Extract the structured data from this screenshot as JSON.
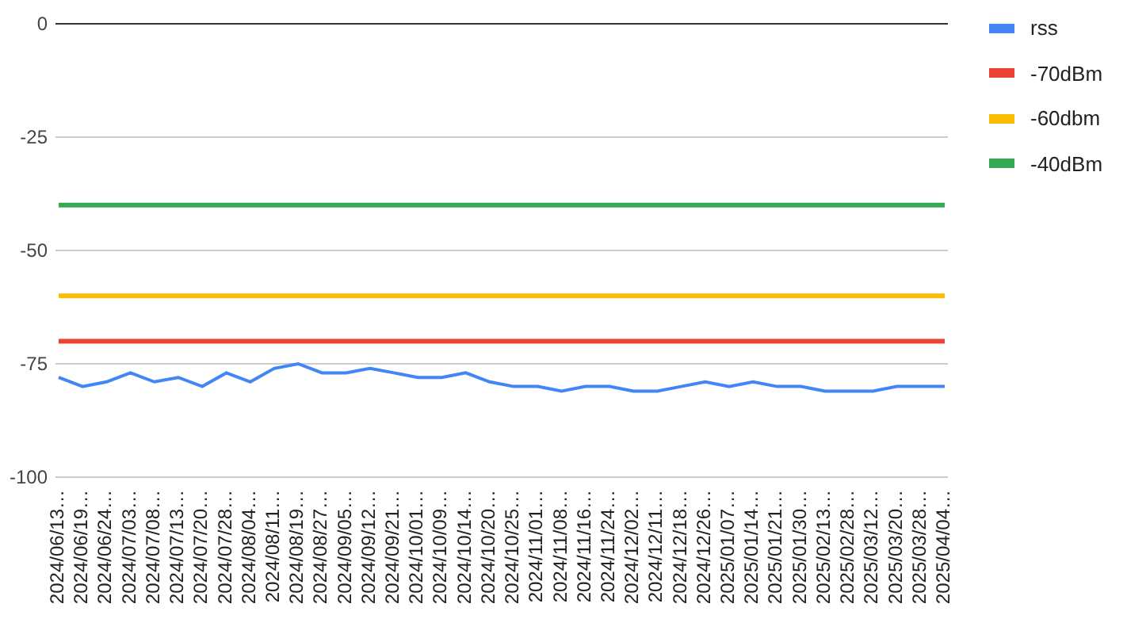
{
  "chart_data": {
    "type": "line",
    "categories": [
      "2024/06/13…",
      "2024/06/19…",
      "2024/06/24…",
      "2024/07/03…",
      "2024/07/08…",
      "2024/07/13…",
      "2024/07/20…",
      "2024/07/28…",
      "2024/08/04…",
      "2024/08/11…",
      "2024/08/19…",
      "2024/08/27…",
      "2024/09/05…",
      "2024/09/12…",
      "2024/09/21…",
      "2024/10/01…",
      "2024/10/09…",
      "2024/10/14…",
      "2024/10/20…",
      "2024/10/25…",
      "2024/11/01…",
      "2024/11/08…",
      "2024/11/16…",
      "2024/11/24…",
      "2024/12/02…",
      "2024/12/11…",
      "2024/12/18…",
      "2024/12/26…",
      "2025/01/07…",
      "2025/01/14…",
      "2025/01/21…",
      "2025/01/30…",
      "2025/02/13…",
      "2025/02/28…",
      "2025/03/12…",
      "2025/03/20…",
      "2025/03/28…",
      "2025/04/04…"
    ],
    "series": [
      {
        "name": "rss",
        "color": "#4285f4",
        "values": [
          -78,
          -80,
          -79,
          -77,
          -79,
          -78,
          -80,
          -77,
          -79,
          -76,
          -75,
          -77,
          -77,
          -76,
          -77,
          -78,
          -78,
          -77,
          -79,
          -80,
          -80,
          -81,
          -80,
          -80,
          -81,
          -81,
          -80,
          -79,
          -80,
          -79,
          -80,
          -80,
          -81,
          -81,
          -81,
          -80,
          -80,
          -80
        ]
      },
      {
        "name": "-70dBm",
        "color": "#ea4335",
        "values": [
          -70,
          -70,
          -70,
          -70,
          -70,
          -70,
          -70,
          -70,
          -70,
          -70,
          -70,
          -70,
          -70,
          -70,
          -70,
          -70,
          -70,
          -70,
          -70,
          -70,
          -70,
          -70,
          -70,
          -70,
          -70,
          -70,
          -70,
          -70,
          -70,
          -70,
          -70,
          -70,
          -70,
          -70,
          -70,
          -70,
          -70,
          -70
        ]
      },
      {
        "name": "-60dbm",
        "color": "#fbbc04",
        "values": [
          -60,
          -60,
          -60,
          -60,
          -60,
          -60,
          -60,
          -60,
          -60,
          -60,
          -60,
          -60,
          -60,
          -60,
          -60,
          -60,
          -60,
          -60,
          -60,
          -60,
          -60,
          -60,
          -60,
          -60,
          -60,
          -60,
          -60,
          -60,
          -60,
          -60,
          -60,
          -60,
          -60,
          -60,
          -60,
          -60,
          -60,
          -60
        ]
      },
      {
        "name": "-40dBm",
        "color": "#34a853",
        "values": [
          -40,
          -40,
          -40,
          -40,
          -40,
          -40,
          -40,
          -40,
          -40,
          -40,
          -40,
          -40,
          -40,
          -40,
          -40,
          -40,
          -40,
          -40,
          -40,
          -40,
          -40,
          -40,
          -40,
          -40,
          -40,
          -40,
          -40,
          -40,
          -40,
          -40,
          -40,
          -40,
          -40,
          -40,
          -40,
          -40,
          -40,
          -40
        ]
      }
    ],
    "grid": true,
    "ylim": [
      -100,
      0
    ],
    "yticks": [
      0,
      -25,
      -50,
      -75,
      -100
    ]
  }
}
